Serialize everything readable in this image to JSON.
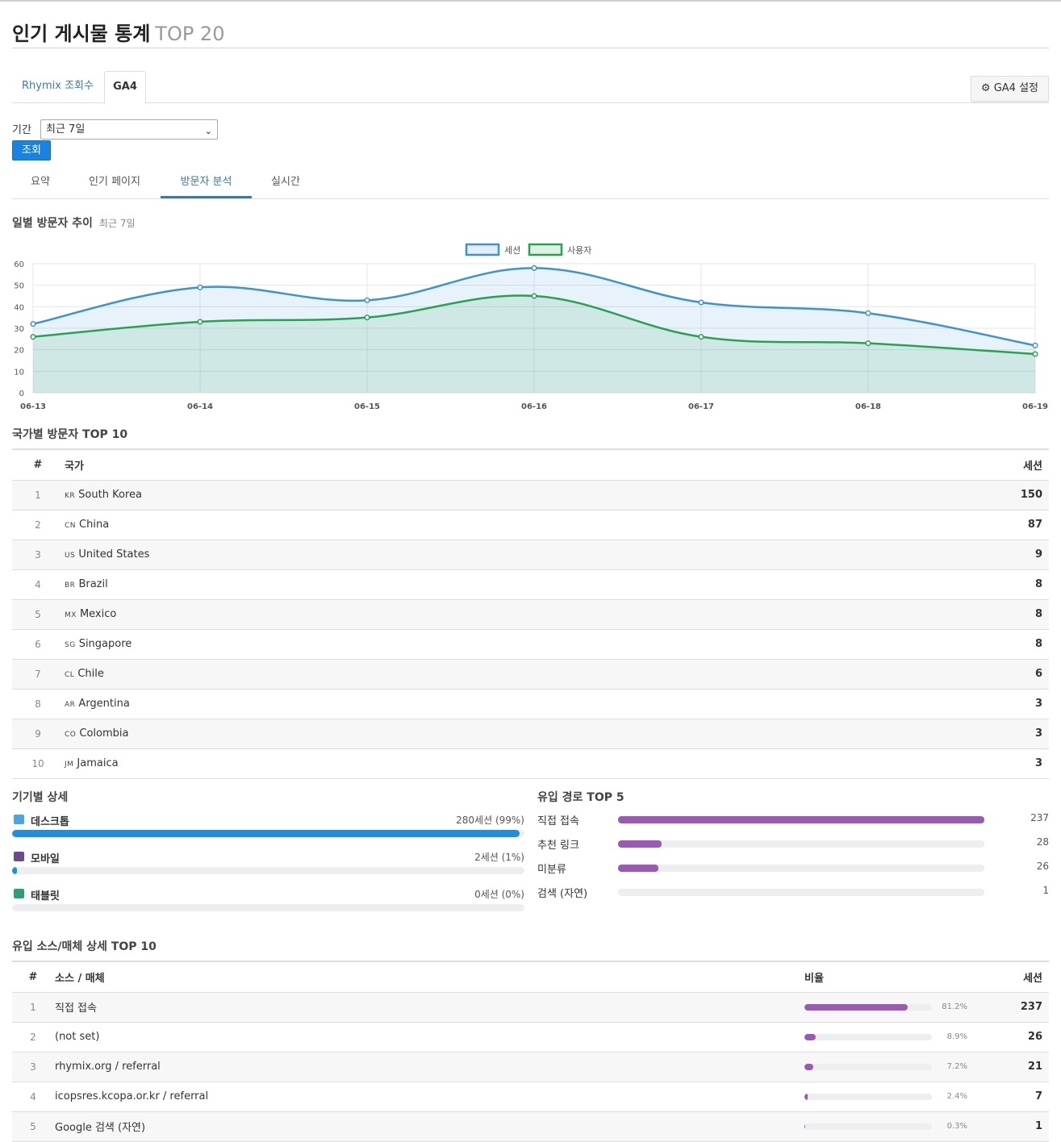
{
  "header": {
    "title": "인기 게시물 통계",
    "subtitle": "TOP 20"
  },
  "top_tabs": [
    {
      "label": "Rhymix 조회수",
      "active": false
    },
    {
      "label": "GA4",
      "active": true
    }
  ],
  "ga4_settings_button": "⚙ GA4 설정",
  "period": {
    "label": "기간",
    "selected": "최근 7일",
    "search_button": "조회"
  },
  "sub_tabs": [
    {
      "label": "요약",
      "active": false
    },
    {
      "label": "인기 페이지",
      "active": false
    },
    {
      "label": "방문자 분석",
      "active": true
    },
    {
      "label": "실시간",
      "active": false
    }
  ],
  "daily_section": {
    "title": "일별 방문자 추이",
    "subtitle": "최근 7일"
  },
  "chart_data": {
    "type": "area",
    "title": "",
    "xlabel": "",
    "ylabel": "",
    "x": [
      "06-13",
      "06-14",
      "06-15",
      "06-16",
      "06-17",
      "06-18",
      "06-19"
    ],
    "ylim": [
      0,
      60
    ],
    "yticks": [
      0,
      10,
      20,
      30,
      40,
      50,
      60
    ],
    "grid": true,
    "legend_position": "top-center",
    "series": [
      {
        "name": "세션",
        "values": [
          32,
          49,
          43,
          58,
          42,
          37,
          22
        ],
        "color": "#3a93d4"
      },
      {
        "name": "사용자",
        "values": [
          26,
          33,
          35,
          45,
          26,
          23,
          18
        ],
        "color": "#27a350"
      }
    ]
  },
  "country_section": {
    "title": "국가별 방문자 TOP 10",
    "columns": [
      "#",
      "국가",
      "세션"
    ],
    "rows": [
      {
        "rank": "1",
        "code": "KR",
        "name": "South Korea",
        "sessions": "150"
      },
      {
        "rank": "2",
        "code": "CN",
        "name": "China",
        "sessions": "87"
      },
      {
        "rank": "3",
        "code": "US",
        "name": "United States",
        "sessions": "9"
      },
      {
        "rank": "4",
        "code": "BR",
        "name": "Brazil",
        "sessions": "8"
      },
      {
        "rank": "5",
        "code": "MX",
        "name": "Mexico",
        "sessions": "8"
      },
      {
        "rank": "6",
        "code": "SG",
        "name": "Singapore",
        "sessions": "8"
      },
      {
        "rank": "7",
        "code": "CL",
        "name": "Chile",
        "sessions": "6"
      },
      {
        "rank": "8",
        "code": "AR",
        "name": "Argentina",
        "sessions": "3"
      },
      {
        "rank": "9",
        "code": "CO",
        "name": "Colombia",
        "sessions": "3"
      },
      {
        "rank": "10",
        "code": "JM",
        "name": "Jamaica",
        "sessions": "3"
      }
    ]
  },
  "device_section": {
    "title": "기기별 상세",
    "items": [
      {
        "icon": "desktop-icon",
        "name": "데스크톱",
        "value": "280세션 (99%)",
        "fraction": 0.99,
        "icon_color": "#4aa6dd"
      },
      {
        "icon": "mobile-icon",
        "name": "모바일",
        "value": "2세션 (1%)",
        "fraction": 0.01,
        "icon_color": "#6a4c8c"
      },
      {
        "icon": "tablet-icon",
        "name": "태블릿",
        "value": "0세션 (0%)",
        "fraction": 0,
        "icon_color": "#2e9e7a"
      }
    ]
  },
  "referral_section": {
    "title": "유입 경로 TOP 5",
    "items": [
      {
        "name": "직접 접속",
        "value": "237",
        "fraction": 1.0
      },
      {
        "name": "추천 링크",
        "value": "28",
        "fraction": 0.118
      },
      {
        "name": "미분류",
        "value": "26",
        "fraction": 0.11
      },
      {
        "name": "검색 (자연)",
        "value": "1",
        "fraction": 0.0
      }
    ]
  },
  "source_section": {
    "title": "유입 소스/매체 상세 TOP 10",
    "columns": [
      "#",
      "소스 / 매체",
      "비율",
      "세션"
    ],
    "rows": [
      {
        "rank": "1",
        "source": "직접 접속",
        "pct": "81.2%",
        "fraction": 0.812,
        "sessions": "237"
      },
      {
        "rank": "2",
        "source": "(not set)",
        "pct": "8.9%",
        "fraction": 0.089,
        "sessions": "26"
      },
      {
        "rank": "3",
        "source": "rhymix.org / referral",
        "pct": "7.2%",
        "fraction": 0.072,
        "sessions": "21"
      },
      {
        "rank": "4",
        "source": "icopsres.kcopa.or.kr / referral",
        "pct": "2.4%",
        "fraction": 0.024,
        "sessions": "7"
      },
      {
        "rank": "5",
        "source": "Google 검색 (자연)",
        "pct": "0.3%",
        "fraction": 0.003,
        "sessions": "1"
      }
    ]
  },
  "colors": {
    "accent": "#337ab7",
    "button": "#1a82e2",
    "purple_bar": "#9b59b6",
    "blue_bar": "#1f8de0"
  }
}
